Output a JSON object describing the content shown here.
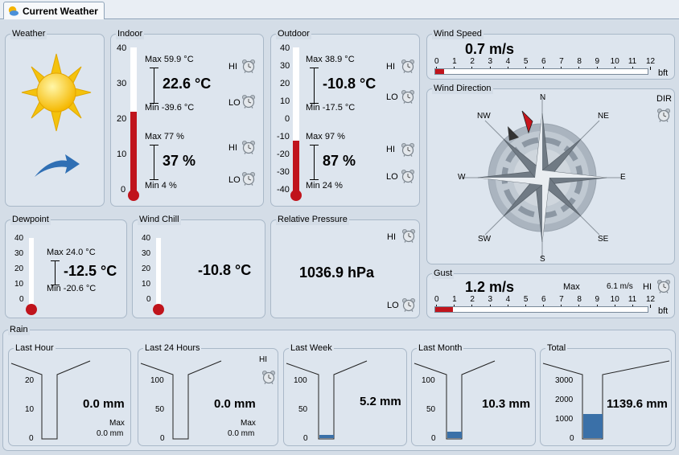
{
  "tab": {
    "label": "Current Weather"
  },
  "weather": {
    "title": "Weather"
  },
  "indoor": {
    "title": "Indoor",
    "scale": [
      "40",
      "30",
      "20",
      "10",
      "0"
    ],
    "temp_max": "Max 59.9 °C",
    "temp": "22.6 °C",
    "temp_min": "Min -39.6 °C",
    "hum_max": "Max 77 %",
    "hum": "37 %",
    "hum_min": "Min 4 %",
    "hi": "HI",
    "lo": "LO",
    "level": 0.565
  },
  "outdoor": {
    "title": "Outdoor",
    "scale": [
      "40",
      "30",
      "20",
      "10",
      "0",
      "-10",
      "-20",
      "-30",
      "-40"
    ],
    "temp_max": "Max 38.9 °C",
    "temp": "-10.8 °C",
    "temp_min": "Min -17.5 °C",
    "hum_max": "Max 97 %",
    "hum": "87 %",
    "hum_min": "Min 24 %",
    "hi": "HI",
    "lo": "LO",
    "level": 0.365
  },
  "wind_speed": {
    "title": "Wind Speed",
    "value": "0.7 m/s",
    "unit": "bft",
    "scale": [
      "0",
      "1",
      "2",
      "3",
      "4",
      "5",
      "6",
      "7",
      "8",
      "9",
      "10",
      "11",
      "12"
    ],
    "level": 0.5
  },
  "wind_direction": {
    "title": "Wind Direction",
    "dir_label": "DIR",
    "compass": [
      "N",
      "NE",
      "E",
      "SE",
      "S",
      "SW",
      "W",
      "NW"
    ]
  },
  "gust": {
    "title": "Gust",
    "value": "1.2 m/s",
    "max_label": "Max",
    "max_value": "6.1 m/s",
    "hi": "HI",
    "unit": "bft",
    "scale": [
      "0",
      "1",
      "2",
      "3",
      "4",
      "5",
      "6",
      "7",
      "8",
      "9",
      "10",
      "11",
      "12"
    ],
    "level": 1.0
  },
  "dewpoint": {
    "title": "Dewpoint",
    "scale": [
      "40",
      "30",
      "20",
      "10",
      "0"
    ],
    "max": "Max 24.0 °C",
    "value": "-12.5 °C",
    "min": "Min -20.6 °C"
  },
  "windchill": {
    "title": "Wind Chill",
    "scale": [
      "40",
      "30",
      "20",
      "10",
      "0"
    ],
    "value": "-10.8 °C"
  },
  "pressure": {
    "title": "Relative Pressure",
    "value": "1036.9 hPa",
    "hi": "HI",
    "lo": "LO"
  },
  "rain": {
    "title": "Rain",
    "last_hour": {
      "title": "Last Hour",
      "scale": [
        "20",
        "10",
        "0"
      ],
      "value": "0.0 mm",
      "max_label": "Max",
      "max_value": "0.0 mm",
      "fill": 0
    },
    "last_24": {
      "title": "Last 24 Hours",
      "scale": [
        "100",
        "50",
        "0"
      ],
      "value": "0.0 mm",
      "max_label": "Max",
      "max_value": "0.0 mm",
      "hi": "HI",
      "fill": 0
    },
    "last_week": {
      "title": "Last Week",
      "scale": [
        "100",
        "50",
        "0"
      ],
      "value": "5.2 mm",
      "fill": 0.052
    },
    "last_month": {
      "title": "Last Month",
      "scale": [
        "100",
        "50",
        "0"
      ],
      "value": "10.3 mm",
      "fill": 0.103
    },
    "total": {
      "title": "Total",
      "scale": [
        "3000",
        "2000",
        "1000",
        "0"
      ],
      "value": "1139.6 mm",
      "fill": 0.38
    }
  },
  "colors": {
    "mercury": "#c0141c",
    "rain": "#3a70a8",
    "accent": "#2f6fb4"
  }
}
